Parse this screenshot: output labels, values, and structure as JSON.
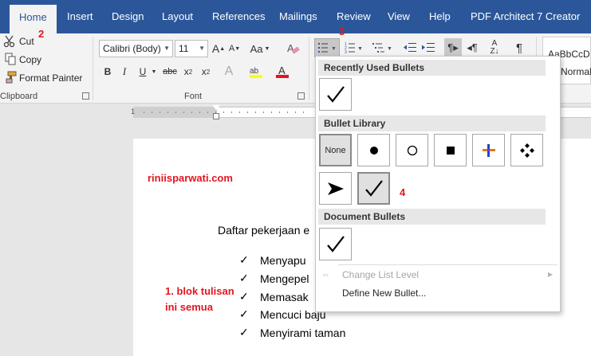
{
  "tabs": [
    {
      "label": "Home",
      "active": true
    },
    {
      "label": "Insert"
    },
    {
      "label": "Design"
    },
    {
      "label": "Layout"
    },
    {
      "label": "References"
    },
    {
      "label": "Mailings"
    },
    {
      "label": "Review"
    },
    {
      "label": "View"
    },
    {
      "label": "Help"
    },
    {
      "label": "PDF Architect 7 Creator"
    }
  ],
  "clipboard": {
    "cut": "Cut",
    "copy": "Copy",
    "format_painter": "Format Painter",
    "group_label": "Clipboard"
  },
  "font": {
    "name": "Calibri (Body)",
    "size": "11",
    "group_label": "Font",
    "bold": "B",
    "italic": "I",
    "underline": "U",
    "strike": "abc",
    "grow": "A",
    "shrink": "A",
    "case": "Aa",
    "clear": "A"
  },
  "styles": {
    "preview": "AaBbCcD",
    "normal": "Normal"
  },
  "annotations": {
    "two": "2",
    "three": "3",
    "four": "4"
  },
  "bullet_menu": {
    "recent_header": "Recently Used Bullets",
    "library_header": "Bullet Library",
    "document_header": "Document Bullets",
    "none_label": "None",
    "change_level": "Change List Level",
    "define_new": "Define New Bullet..."
  },
  "document": {
    "watermark": "riniisparwati.com",
    "heading": "Daftar pekerjaan e",
    "instruction_line1": "1. blok tulisan",
    "instruction_line2": "ini semua",
    "items": [
      "Menyapu",
      "Mengepel",
      "Memasak",
      "Mencuci baju",
      "Menyirami taman"
    ]
  },
  "colors": {
    "accent": "#2b579a",
    "annotation_red": "#e3161f",
    "ribbon_bg": "#f3f3f3"
  }
}
